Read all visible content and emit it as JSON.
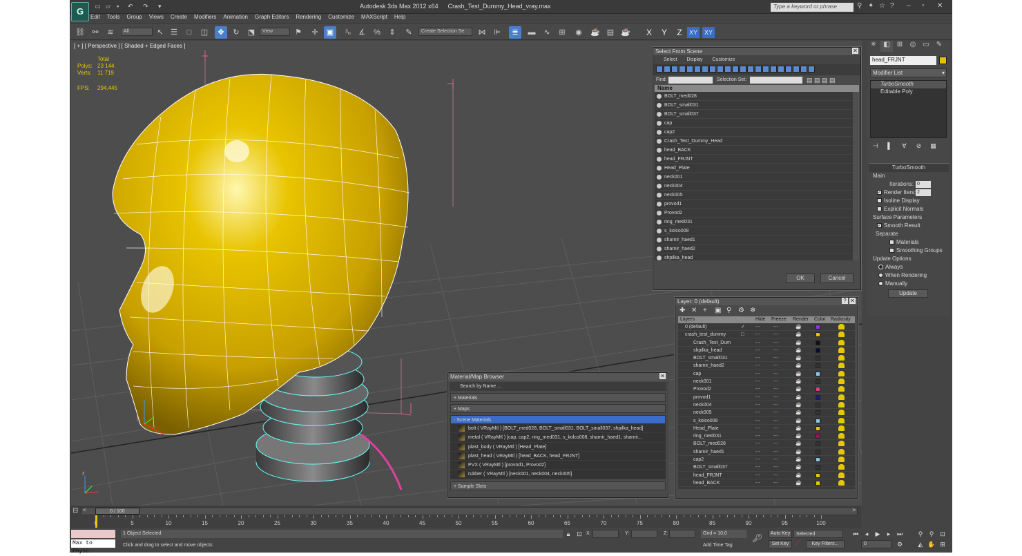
{
  "app": {
    "title": "Autodesk 3ds Max  2012 x64",
    "file": "Crash_Test_Dummy_Head_vray.max",
    "search_placeholder": "Type a keyword or phrase",
    "logo": "max-logo"
  },
  "menu": [
    "Edit",
    "Tools",
    "Group",
    "Views",
    "Create",
    "Modifiers",
    "Animation",
    "Graph Editors",
    "Rendering",
    "Customize",
    "MAXScript",
    "Help"
  ],
  "toolbar": {
    "filter": "All",
    "refcoord": "View",
    "selset": "Create Selection Se",
    "axes": [
      "X",
      "Y",
      "Z",
      "XY",
      "XY"
    ]
  },
  "viewport": {
    "label": "[ + ] [ Perspective ] [ Shaded + Edged Faces ]",
    "stats": {
      "total_label": "Total",
      "polys_label": "Polys:",
      "polys": "23 144",
      "verts_label": "Verts:",
      "verts": "11 719",
      "fps_label": "FPS:",
      "fps": "294,445"
    },
    "accent": "#e6c800"
  },
  "command_panel": {
    "object_name": "head_FRJNT",
    "object_color": "#e8c000",
    "modifier_list": "Modifier List",
    "stack": [
      "TurboSmooth",
      "Editable Poly"
    ],
    "turbosmooth": {
      "title": "TurboSmooth",
      "main": "Main",
      "iterations_label": "Iterations:",
      "iterations": "0",
      "render_iters_label": "Render Iters:",
      "render_iters": "2",
      "isoline": "Isoline Display",
      "explicit": "Explicit Normals",
      "surface": "Surface Parameters",
      "smooth_result": "Smooth Result",
      "separate": "Separate",
      "materials": "Materials",
      "smoothing_groups": "Smoothing Groups",
      "update_options": "Update Options",
      "always": "Always",
      "when_rendering": "When Rendering",
      "manually": "Manually",
      "update": "Update"
    }
  },
  "select_from_scene": {
    "title": "Select From Scene",
    "menu": [
      "Select",
      "Display",
      "Customize"
    ],
    "find_label": "Find:",
    "selset_label": "Selection Set:",
    "col_name": "Name",
    "items": [
      "BOLT_med028",
      "BOLT_small031",
      "BOLT_small037",
      "cap",
      "cap2",
      "Crash_Test_Dummy_Head",
      "head_BACK",
      "head_FRJNT",
      "Head_Plate",
      "neck001",
      "neck004",
      "neck005",
      "provod1",
      "Provod2",
      "ring_med031",
      "s_kolco008",
      "sharnir_haed1",
      "sharnir_haed2",
      "shpilka_head"
    ],
    "ok": "OK",
    "cancel": "Cancel"
  },
  "layer_dialog": {
    "title": "Layer: 0 (default)",
    "help": "?",
    "cols": [
      "Layers",
      "Hide",
      "Freeze",
      "Render",
      "Color",
      "Radiosity"
    ],
    "rows": [
      {
        "name": "0 (default)",
        "indent": 1,
        "color": "#8a3ad0",
        "check": "✓"
      },
      {
        "name": "crash_test_dummy",
        "indent": 1,
        "color": "#e6c800",
        "check": "□"
      },
      {
        "name": "Crash_Test_Dum",
        "indent": 2,
        "color": "#111111"
      },
      {
        "name": "shpilka_head",
        "indent": 2,
        "color": "#0a0a40"
      },
      {
        "name": "BOLT_small031",
        "indent": 2,
        "color": "#333333"
      },
      {
        "name": "sharnir_haed2",
        "indent": 2,
        "color": "#333333"
      },
      {
        "name": "cap",
        "indent": 2,
        "color": "#8ac8e8"
      },
      {
        "name": "neck001",
        "indent": 2,
        "color": "#333333"
      },
      {
        "name": "Provod2",
        "indent": 2,
        "color": "#e04080"
      },
      {
        "name": "provod1",
        "indent": 2,
        "color": "#1a1a80"
      },
      {
        "name": "neck004",
        "indent": 2,
        "color": "#333333"
      },
      {
        "name": "neck005",
        "indent": 2,
        "color": "#333333"
      },
      {
        "name": "s_kolco008",
        "indent": 2,
        "color": "#8ac8e8"
      },
      {
        "name": "Head_Plate",
        "indent": 2,
        "color": "#e6c800"
      },
      {
        "name": "ring_med031",
        "indent": 2,
        "color": "#a01060"
      },
      {
        "name": "BOLT_med028",
        "indent": 2,
        "color": "#333333"
      },
      {
        "name": "sharnir_haed1",
        "indent": 2,
        "color": "#333333"
      },
      {
        "name": "cap2",
        "indent": 2,
        "color": "#8ac8e8"
      },
      {
        "name": "BOLT_small037",
        "indent": 2,
        "color": "#333333"
      },
      {
        "name": "head_FRJNT",
        "indent": 2,
        "color": "#e6c800"
      },
      {
        "name": "head_BACK",
        "indent": 2,
        "color": "#e6c800"
      }
    ]
  },
  "material_browser": {
    "title": "Material/Map Browser",
    "search": "Search by Name ...",
    "materials": "+ Materials",
    "maps": "+ Maps",
    "scene_materials": "- Scene Materials",
    "sample_slots": "+ Sample Slots",
    "items": [
      "bolt  ( VRayMtl ) [BOLT_med028, BOLT_small031, BOLT_small037, shpilka_head]",
      "metal  ( VRayMtl ) [cap, cap2, ring_med031, s_kolco008, sharnir_haed1, sharnir...",
      "plast_body  ( VRayMtl ) [Head_Plate]",
      "plast_head  ( VRayMtl ) [head_BACK, head_FRJNT]",
      "PVX  ( VRayMtl ) [provod1, Provod2]",
      "rubber  ( VRayMtl ) [neck001, neck004, neck005]"
    ]
  },
  "timeline": {
    "frame": "0 / 100",
    "ticks": [
      "0",
      "5",
      "10",
      "15",
      "20",
      "25",
      "30",
      "35",
      "40",
      "45",
      "50",
      "55",
      "60",
      "65",
      "70",
      "75",
      "80",
      "85",
      "90",
      "95",
      "100"
    ]
  },
  "status": {
    "maxscript": "Max to Physc.",
    "selected": "1 Object Selected",
    "prompt": "Click and drag to select and move objects",
    "x_label": "X:",
    "y_label": "Y:",
    "z_label": "Z:",
    "grid": "Grid = 10,0",
    "add_time_tag": "Add Time Tag",
    "auto_key": "Auto Key",
    "set_key": "Set Key",
    "key_mode": "Selected",
    "key_filters": "Key Filters...",
    "frame": "0"
  }
}
